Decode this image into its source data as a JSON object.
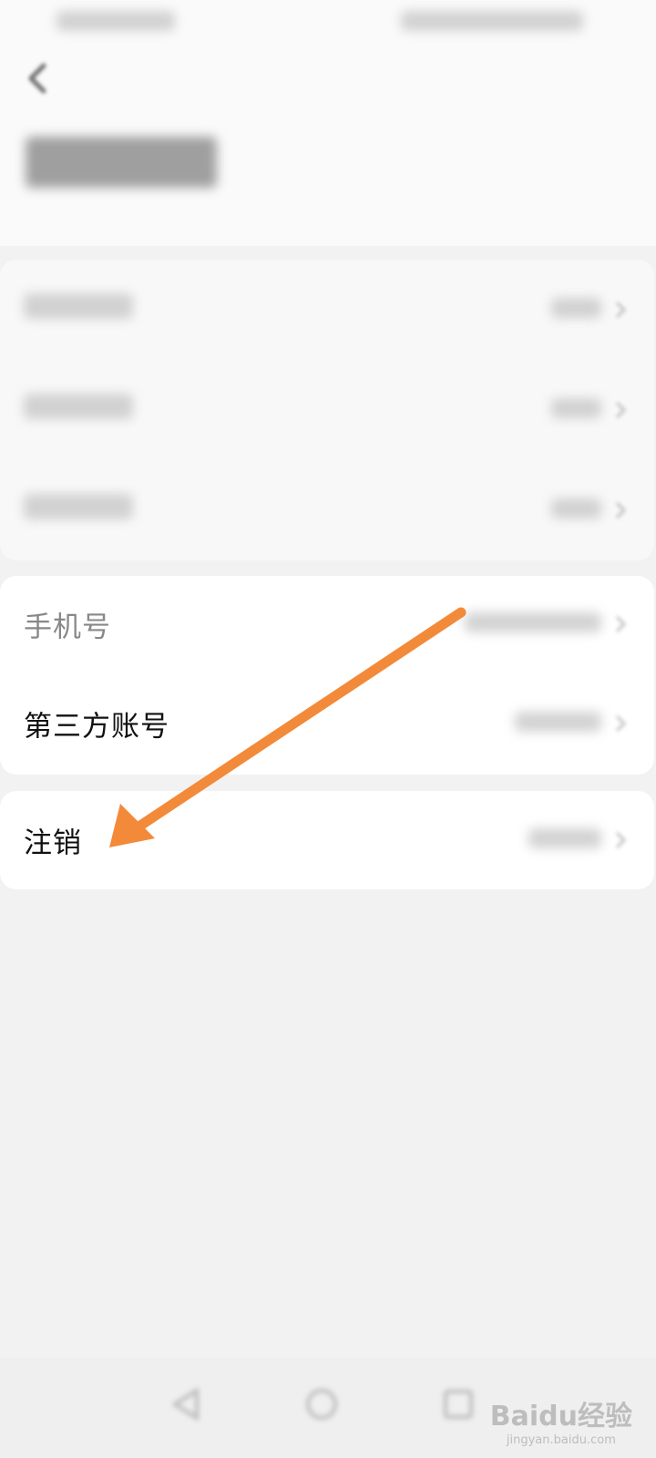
{
  "colors": {
    "background": "#f2f2f2",
    "card": "#ffffff",
    "arrow": "#f28a3a",
    "muted_text": "#888888"
  },
  "status_bar": {
    "obscured": true
  },
  "header": {
    "back_icon": "chevron-left-icon",
    "title_obscured": true
  },
  "security_group": {
    "rows": [
      {
        "label_obscured": true,
        "value_obscured": true
      },
      {
        "label_obscured": true,
        "value_obscured": true
      },
      {
        "label_obscured": true,
        "value_obscured": true
      }
    ]
  },
  "account_group": {
    "phone_label": "手机号",
    "third_party_label": "第三方账号"
  },
  "cancel_group": {
    "cancel_label": "注销"
  },
  "annotation": {
    "type": "arrow",
    "points_to": "cancel-row"
  },
  "nav_bar": {
    "icons": [
      "back-triangle-icon",
      "home-circle-icon",
      "recents-square-icon"
    ]
  },
  "watermark": {
    "text": "Baidu经验",
    "url": "jingyan.baidu.com"
  }
}
